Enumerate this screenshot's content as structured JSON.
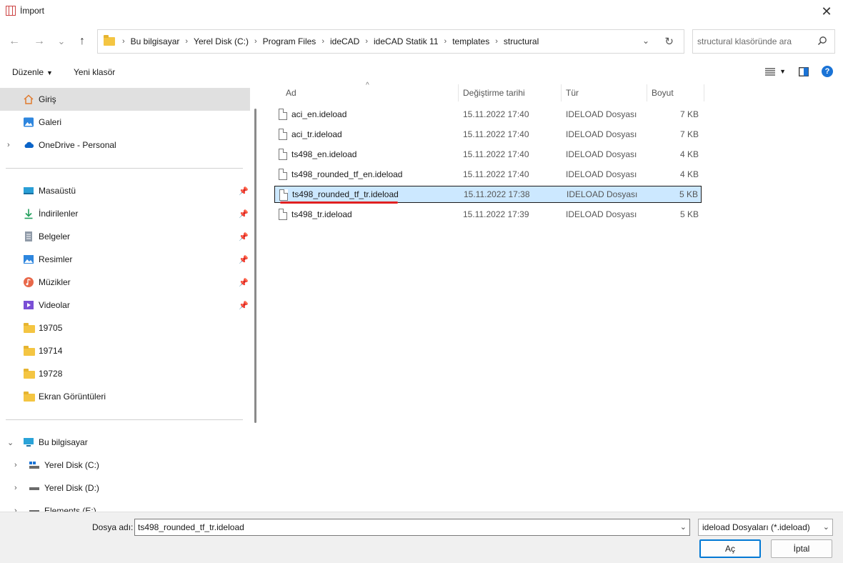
{
  "window": {
    "title": "İmport",
    "close_glyph": "✕"
  },
  "nav": {
    "back": "←",
    "forward": "→",
    "recent": "⌄",
    "up": "↑"
  },
  "breadcrumb": [
    "Bu bilgisayar",
    "Yerel Disk (C:)",
    "Program Files",
    "ideCAD",
    "ideCAD Statik 11",
    "templates",
    "structural"
  ],
  "search": {
    "placeholder": "structural klasöründe ara"
  },
  "toolbar": {
    "organize": "Düzenle",
    "new_folder": "Yeni klasör"
  },
  "sidebar": {
    "quick": [
      {
        "label": "Giriş",
        "icon": "home-icon",
        "selected": true
      },
      {
        "label": "Galeri",
        "icon": "gallery-icon"
      },
      {
        "label": "OneDrive - Personal",
        "icon": "cloud-icon"
      }
    ],
    "pinned": [
      {
        "label": "Masaüstü",
        "icon": "desktop-icon"
      },
      {
        "label": "İndirilenler",
        "icon": "download-icon"
      },
      {
        "label": "Belgeler",
        "icon": "documents-icon"
      },
      {
        "label": "Resimler",
        "icon": "pictures-icon"
      },
      {
        "label": "Müzikler",
        "icon": "music-icon"
      },
      {
        "label": "Videolar",
        "icon": "videos-icon"
      },
      {
        "label": "19705",
        "icon": "folder-icon"
      },
      {
        "label": "19714",
        "icon": "folder-icon"
      },
      {
        "label": "19728",
        "icon": "folder-icon"
      },
      {
        "label": "Ekran Görüntüleri",
        "icon": "folder-icon"
      }
    ],
    "computer": {
      "label": "Bu bilgisayar"
    },
    "drives": [
      {
        "label": "Yerel Disk (C:)"
      },
      {
        "label": "Yerel Disk (D:)"
      },
      {
        "label": "Elements (E:)"
      }
    ]
  },
  "columns": {
    "name": "Ad",
    "date": "Değiştirme tarihi",
    "type": "Tür",
    "size": "Boyut"
  },
  "files": [
    {
      "name": "aci_en.ideload",
      "date": "15.11.2022 17:40",
      "type": "IDELOAD Dosyası",
      "size": "7 KB"
    },
    {
      "name": "aci_tr.ideload",
      "date": "15.11.2022 17:40",
      "type": "IDELOAD Dosyası",
      "size": "7 KB"
    },
    {
      "name": "ts498_en.ideload",
      "date": "15.11.2022 17:40",
      "type": "IDELOAD Dosyası",
      "size": "4 KB"
    },
    {
      "name": "ts498_rounded_tf_en.ideload",
      "date": "15.11.2022 17:40",
      "type": "IDELOAD Dosyası",
      "size": "4 KB"
    },
    {
      "name": "ts498_rounded_tf_tr.ideload",
      "date": "15.11.2022 17:38",
      "type": "IDELOAD Dosyası",
      "size": "5 KB",
      "selected": true
    },
    {
      "name": "ts498_tr.ideload",
      "date": "15.11.2022 17:39",
      "type": "IDELOAD Dosyası",
      "size": "5 KB"
    }
  ],
  "footer": {
    "filename_label": "Dosya adı:",
    "filename_value": "ts498_rounded_tf_tr.ideload",
    "filetype": "ideload Dosyaları (*.ideload)",
    "open": "Aç",
    "cancel": "İptal"
  },
  "colors": {
    "selection": "#cce8ff",
    "accent": "#0078d4",
    "highlight_underline": "#e02020"
  }
}
